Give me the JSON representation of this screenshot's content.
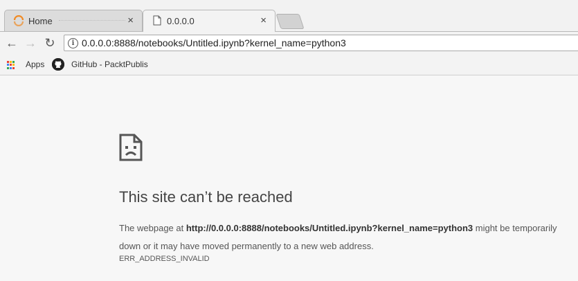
{
  "tabs": [
    {
      "title": "Home",
      "close": "×"
    },
    {
      "title": "0.0.0.0",
      "close": "×"
    }
  ],
  "toolbar": {
    "back": "←",
    "forward": "→",
    "reload": "↻",
    "info_icon": "i",
    "url": "0.0.0.0:8888/notebooks/Untitled.ipynb?kernel_name=python3"
  },
  "bookmarks": [
    {
      "label": "Apps",
      "icon": "apps-grid-icon"
    },
    {
      "label": "GitHub - PacktPublis",
      "icon": "github-icon"
    }
  ],
  "error": {
    "heading": "This site can’t be reached",
    "desc_prefix": "The webpage at ",
    "desc_url": "http://0.0.0.0:8888/notebooks/Untitled.ipynb?kernel_name=python3",
    "desc_suffix": " might be temporarily down or it may have moved permanently to a new web address.",
    "code": "ERR_ADDRESS_INVALID"
  },
  "colors": {
    "spinner": "#f08a24",
    "apps_grid": [
      "#e94235",
      "#fbbc04",
      "#34a853",
      "#4285f4"
    ]
  }
}
